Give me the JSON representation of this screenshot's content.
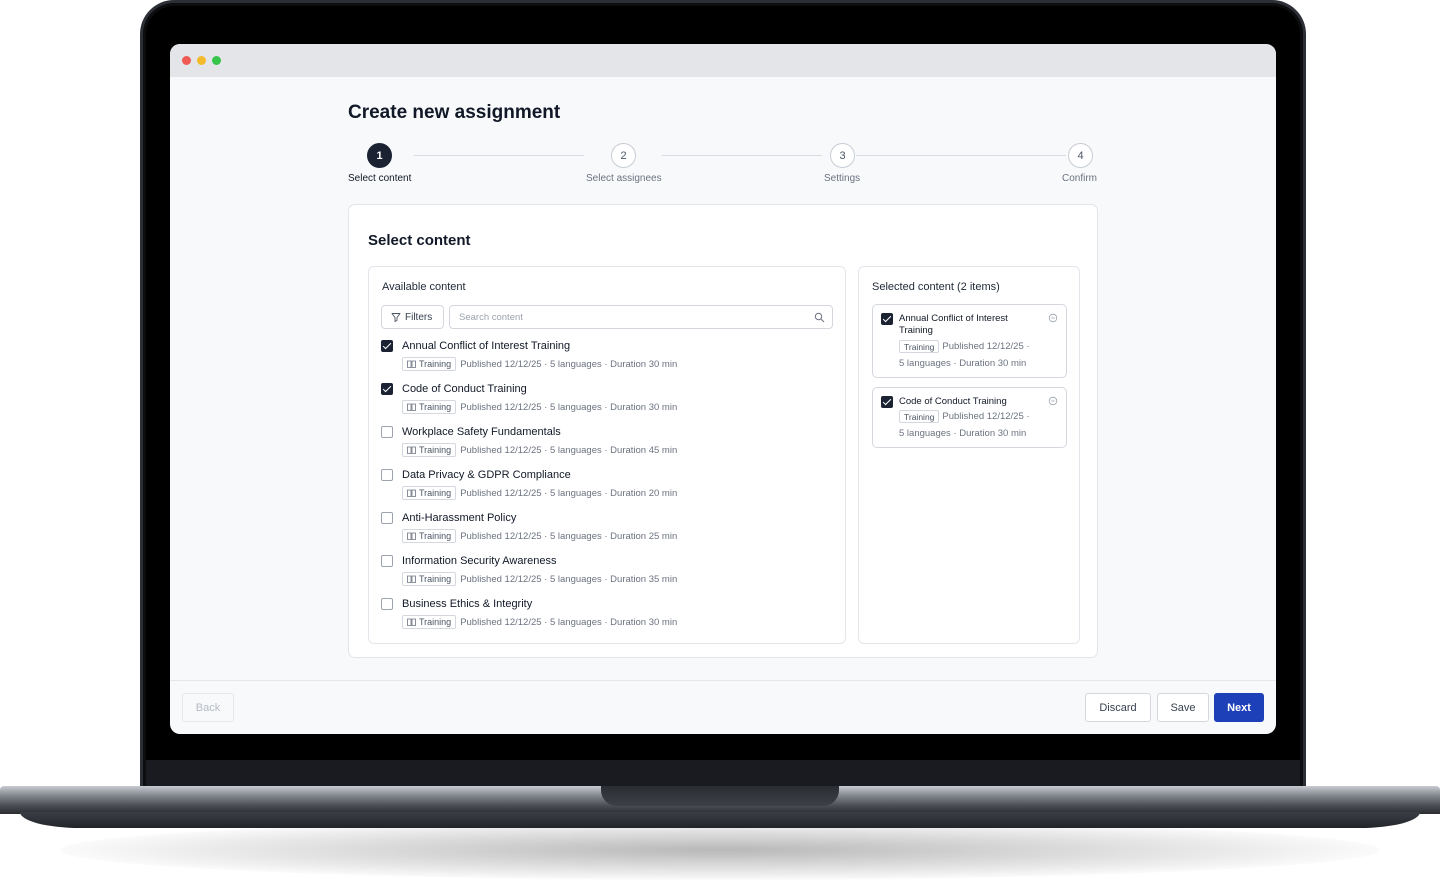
{
  "page": {
    "title": "Create new assignment"
  },
  "stepper": {
    "steps": [
      {
        "number": "1",
        "label": "Select content",
        "active": true
      },
      {
        "number": "2",
        "label": "Select assignees",
        "active": false
      },
      {
        "number": "3",
        "label": "Settings",
        "active": false
      },
      {
        "number": "4",
        "label": "Confirm",
        "active": false
      }
    ]
  },
  "card": {
    "title": "Select content"
  },
  "available": {
    "title": "Available content",
    "filters_label": "Filters",
    "search_placeholder": "Search content",
    "items": [
      {
        "title": "Annual Conflict of Interest Training",
        "tag": "Training",
        "meta": "Published 12/12/25 · 5 languages · Duration 30 min",
        "checked": true
      },
      {
        "title": "Code of Conduct Training",
        "tag": "Training",
        "meta": "Published 12/12/25 · 5 languages · Duration 30 min",
        "checked": true
      },
      {
        "title": "Workplace Safety Fundamentals",
        "tag": "Training",
        "meta": "Published 12/12/25 · 5 languages · Duration 45 min",
        "checked": false
      },
      {
        "title": "Data Privacy & GDPR Compliance",
        "tag": "Training",
        "meta": "Published 12/12/25 · 5 languages · Duration 20 min",
        "checked": false
      },
      {
        "title": "Anti-Harassment Policy",
        "tag": "Training",
        "meta": "Published 12/12/25 · 5 languages · Duration 25 min",
        "checked": false
      },
      {
        "title": "Information Security Awareness",
        "tag": "Training",
        "meta": "Published 12/12/25 · 5 languages · Duration 35 min",
        "checked": false
      },
      {
        "title": "Business Ethics & Integrity",
        "tag": "Training",
        "meta": "Published 12/12/25 · 5 languages · Duration 30 min",
        "checked": false
      }
    ]
  },
  "selected": {
    "title": "Selected content (2 items)",
    "items": [
      {
        "title": "Annual Conflict of Interest Training",
        "tag": "Training",
        "meta1": "Published 12/12/25 ·",
        "meta2": "5 languages · Duration 30 min"
      },
      {
        "title": "Code of Conduct Training",
        "tag": "Training",
        "meta1": "Published 12/12/25 ·",
        "meta2": "5 languages · Duration 30 min"
      }
    ]
  },
  "footer": {
    "back_label": "Back",
    "discard_label": "Discard",
    "save_label": "Save",
    "next_label": "Next"
  },
  "colors": {
    "primary": "#1d3fb8",
    "dark": "#1b2333",
    "window_bg": "#f8f9fb"
  }
}
